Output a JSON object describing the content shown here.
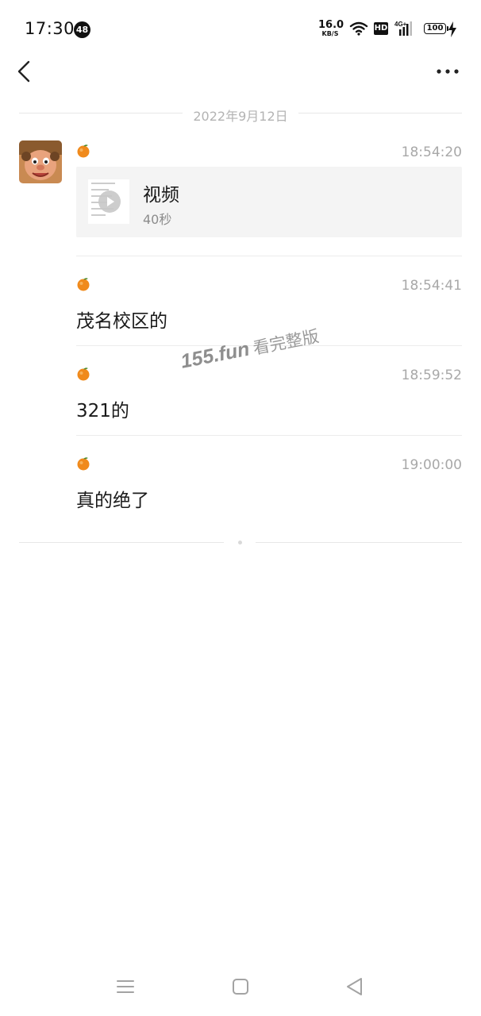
{
  "status_bar": {
    "time": "17:30",
    "notification_count": "48",
    "net_speed_value": "16.0",
    "net_speed_unit": "KB/S",
    "hd_label": "HD",
    "network_type": "4G+",
    "battery_level": "100"
  },
  "header": {
    "back_icon": "chevron-left-icon",
    "more_icon": "more-dots-icon"
  },
  "date_divider": "2022年9月12日",
  "messages": [
    {
      "sender_icon": "orange-emoji-icon",
      "time": "18:54:20",
      "type": "video",
      "video": {
        "title": "视频",
        "duration": "40秒"
      }
    },
    {
      "sender_icon": "orange-emoji-icon",
      "time": "18:54:41",
      "type": "text",
      "text": "茂名校区的"
    },
    {
      "sender_icon": "orange-emoji-icon",
      "time": "18:59:52",
      "type": "text",
      "text": "321的"
    },
    {
      "sender_icon": "orange-emoji-icon",
      "time": "19:00:00",
      "type": "text",
      "text": "真的绝了"
    }
  ],
  "watermark": {
    "site": "155.fun",
    "text": "看完整版"
  },
  "nav_bar": {
    "menu_icon": "menu-icon",
    "home_icon": "home-square-icon",
    "back_icon": "back-triangle-icon"
  },
  "colors": {
    "background": "#ffffff",
    "timestamp": "#a8a8a8",
    "divider": "#ececec",
    "video_card_bg": "#f4f4f4"
  }
}
